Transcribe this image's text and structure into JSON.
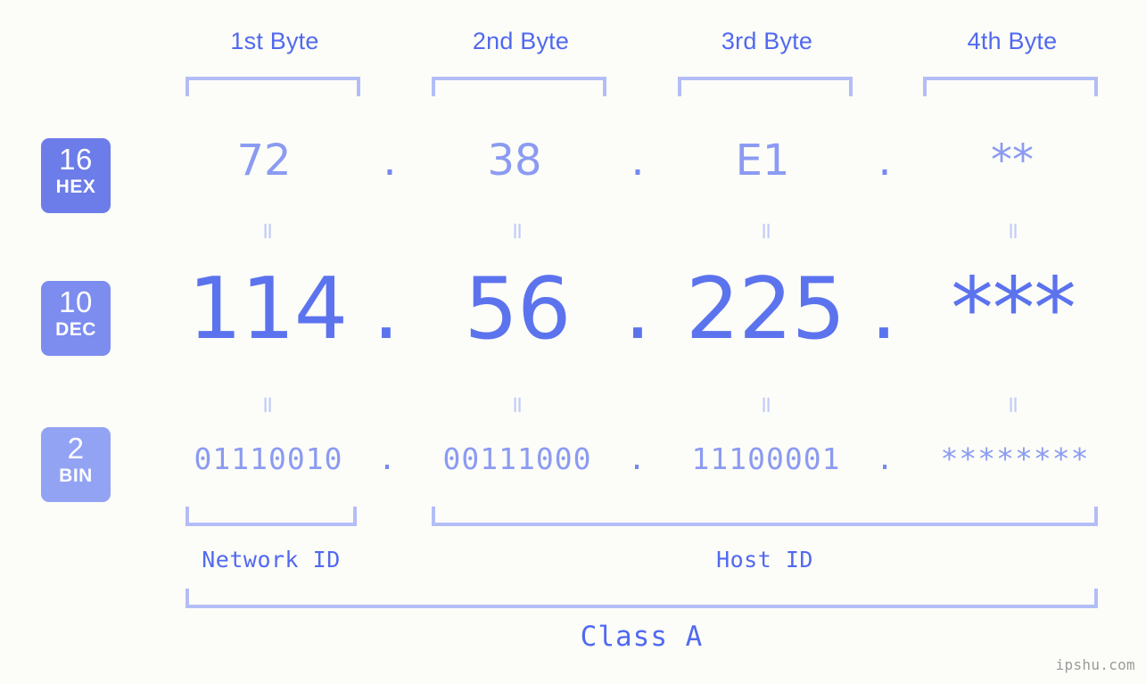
{
  "background_color": "#fcfdf8",
  "accent_color": "#5169f0",
  "bracket_color": "#b3bdf7",
  "byte_headers": [
    {
      "label": "1st Byte"
    },
    {
      "label": "2nd Byte"
    },
    {
      "label": "3rd Byte"
    },
    {
      "label": "4th Byte"
    }
  ],
  "bases": [
    {
      "id": "hex",
      "number": "16",
      "abbr": "HEX",
      "color": "#6c7ce8"
    },
    {
      "id": "dec",
      "number": "10",
      "abbr": "DEC",
      "color": "#7d8cef"
    },
    {
      "id": "bin",
      "number": "2",
      "abbr": "BIN",
      "color": "#93a3f4"
    }
  ],
  "separator": ".",
  "equals_mark": "=",
  "rows": {
    "hex": {
      "octets": [
        "72",
        "38",
        "E1",
        "**"
      ]
    },
    "dec": {
      "octets": [
        "114",
        "56",
        "225",
        "***"
      ]
    },
    "bin": {
      "octets": [
        "01110010",
        "00111000",
        "11100001",
        "********"
      ]
    }
  },
  "segments": {
    "network_id": "Network ID",
    "host_id": "Host ID",
    "class": "Class A"
  },
  "watermark": "ipshu.com"
}
